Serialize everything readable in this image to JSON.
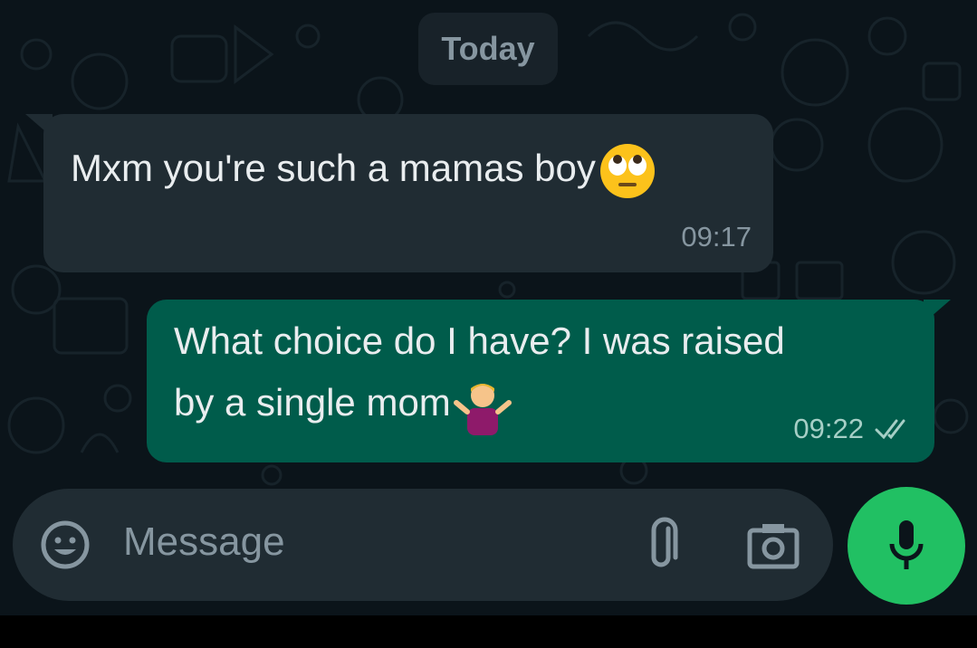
{
  "date_separator": "Today",
  "messages": [
    {
      "direction": "incoming",
      "text": "Mxm you're such a mamas boy",
      "emoji": "face-with-rolling-eyes-emoji",
      "time": "09:17"
    },
    {
      "direction": "outgoing",
      "text_line1": "What choice do I have? I was raised",
      "text_line2": "by a single mom",
      "emoji": "man-shrugging-emoji",
      "time": "09:22",
      "status": "double-check-read-icon"
    }
  ],
  "composer": {
    "placeholder": "Message",
    "icons": [
      "emoji-icon",
      "attach-icon",
      "camera-icon",
      "mic-icon"
    ]
  },
  "colors": {
    "background": "#0b141a",
    "incoming_bubble": "#202c33",
    "outgoing_bubble": "#005c4b",
    "accent_green": "#21c063"
  }
}
